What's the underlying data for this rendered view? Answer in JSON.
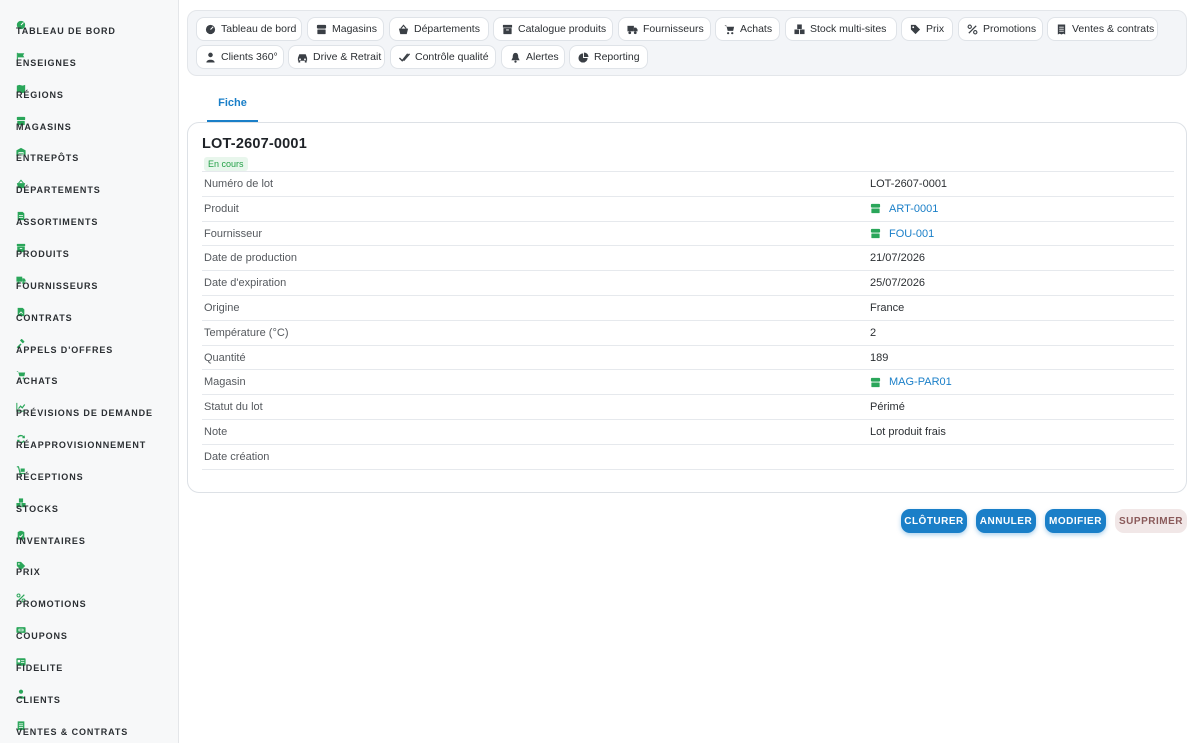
{
  "sidebar": {
    "items": [
      {
        "label": "TABLEAU DE BORD",
        "icon": "dashboard-icon"
      },
      {
        "label": "ENSEIGNES",
        "icon": "flag-icon"
      },
      {
        "label": "RÉGIONS",
        "icon": "map-icon"
      },
      {
        "label": "MAGASINS",
        "icon": "store-icon"
      },
      {
        "label": "ENTREPÔTS",
        "icon": "warehouse-icon"
      },
      {
        "label": "DÉPARTEMENTS",
        "icon": "basket-icon"
      },
      {
        "label": "ASSORTIMENTS",
        "icon": "document-icon"
      },
      {
        "label": "PRODUITS",
        "icon": "box-icon"
      },
      {
        "label": "FOURNISSEURS",
        "icon": "truck-icon"
      },
      {
        "label": "CONTRATS",
        "icon": "contract-icon"
      },
      {
        "label": "APPELS D'OFFRES",
        "icon": "gavel-icon"
      },
      {
        "label": "ACHATS",
        "icon": "cart-icon"
      },
      {
        "label": "PRÉVISIONS DE DEMANDE",
        "icon": "chart-line-icon"
      },
      {
        "label": "RÉAPPROVISIONNEMENT",
        "icon": "refresh-icon"
      },
      {
        "label": "RÉCEPTIONS",
        "icon": "dolly-icon"
      },
      {
        "label": "STOCKS",
        "icon": "boxes-icon"
      },
      {
        "label": "INVENTAIRES",
        "icon": "clipboard-icon"
      },
      {
        "label": "PRIX",
        "icon": "tags-icon"
      },
      {
        "label": "PROMOTIONS",
        "icon": "percent-icon"
      },
      {
        "label": "COUPONS",
        "icon": "ticket-icon"
      },
      {
        "label": "FIDELITE",
        "icon": "card-icon"
      },
      {
        "label": "CLIENTS",
        "icon": "user-icon"
      },
      {
        "label": "VENTES & CONTRATS",
        "icon": "receipt-icon"
      }
    ]
  },
  "topnav": {
    "row1": [
      {
        "label": "Tableau de bord",
        "icon": "dashboard-icon"
      },
      {
        "label": "Magasins",
        "icon": "store-icon"
      },
      {
        "label": "Départements",
        "icon": "basket-icon"
      },
      {
        "label": "Catalogue produits",
        "icon": "box-icon"
      },
      {
        "label": "Fournisseurs",
        "icon": "truck-icon"
      },
      {
        "label": "Achats",
        "icon": "cart-icon"
      },
      {
        "label": "Stock multi-sites",
        "icon": "boxes-icon"
      },
      {
        "label": "Prix",
        "icon": "tags-icon"
      },
      {
        "label": "Promotions",
        "icon": "percent-icon"
      },
      {
        "label": "Ventes & contrats",
        "icon": "receipt-icon"
      }
    ],
    "row2": [
      {
        "label": "Clients 360°",
        "icon": "user-icon"
      },
      {
        "label": "Drive & Retrait",
        "icon": "car-icon"
      },
      {
        "label": "Contrôle qualité",
        "icon": "check-double-icon"
      },
      {
        "label": "Alertes",
        "icon": "bell-icon"
      },
      {
        "label": "Reporting",
        "icon": "pie-chart-icon"
      }
    ]
  },
  "tabs": [
    {
      "label": "Fiche"
    }
  ],
  "record": {
    "title": "LOT-2607-0001",
    "status_badge": "En cours",
    "fields": [
      {
        "key": "Numéro de lot",
        "value": "LOT-2607-0001",
        "link": false
      },
      {
        "key": "Produit",
        "value": "ART-0001",
        "link": true
      },
      {
        "key": "Fournisseur",
        "value": "FOU-001",
        "link": true
      },
      {
        "key": "Date de production",
        "value": "21/07/2026",
        "link": false
      },
      {
        "key": "Date d'expiration",
        "value": "25/07/2026",
        "link": false
      },
      {
        "key": "Origine",
        "value": "France",
        "link": false
      },
      {
        "key": "Température (°C)",
        "value": "2",
        "link": false
      },
      {
        "key": "Quantité",
        "value": "189",
        "link": false
      },
      {
        "key": "Magasin",
        "value": "MAG-PAR01",
        "link": true
      },
      {
        "key": "Statut du lot",
        "value": "Périmé",
        "link": false
      },
      {
        "key": "Note",
        "value": "Lot produit frais",
        "link": false
      },
      {
        "key": "Date création",
        "value": "",
        "link": false
      }
    ]
  },
  "actions": {
    "close_label": "CLÔTURER",
    "cancel_label": "ANNULER",
    "edit_label": "MODIFIER",
    "delete_label": "SUPPRIMER"
  },
  "colors": {
    "accent": "#1a7fc8",
    "sidebar_icon": "#2aa65a",
    "badge_bg": "#e8f6ec",
    "badge_text": "#23a047",
    "danger_bg": "#f1e7e7"
  }
}
